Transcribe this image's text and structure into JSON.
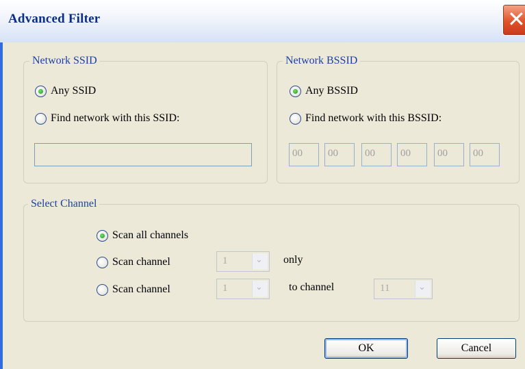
{
  "window": {
    "title": "Advanced Filter",
    "close_glyph": "✕"
  },
  "ssid": {
    "legend": "Network SSID",
    "any_label": "Any SSID",
    "find_label": "Find network with this SSID:",
    "value": "",
    "selected": "any"
  },
  "bssid": {
    "legend": "Network BSSID",
    "any_label": "Any BSSID",
    "find_label": "Find network with this BSSID:",
    "octets": [
      "00",
      "00",
      "00",
      "00",
      "00",
      "00"
    ],
    "selected": "any"
  },
  "channel": {
    "legend": "Select Channel",
    "all_label": "Scan all channels",
    "single_label": "Scan channel",
    "single_value": "1",
    "only_label": "only",
    "range_label": "Scan channel",
    "range_from": "1",
    "to_label": "to channel",
    "range_to": "11",
    "selected": "all"
  },
  "buttons": {
    "ok": "OK",
    "cancel": "Cancel"
  },
  "icons": {
    "dropdown": "chevron-down-icon",
    "close": "close-icon"
  },
  "colors": {
    "title_text": "#0b2f84",
    "legend_text": "#1c3fa4",
    "close_red": "#e0532b",
    "dialog_bg": "#ece9d8"
  }
}
